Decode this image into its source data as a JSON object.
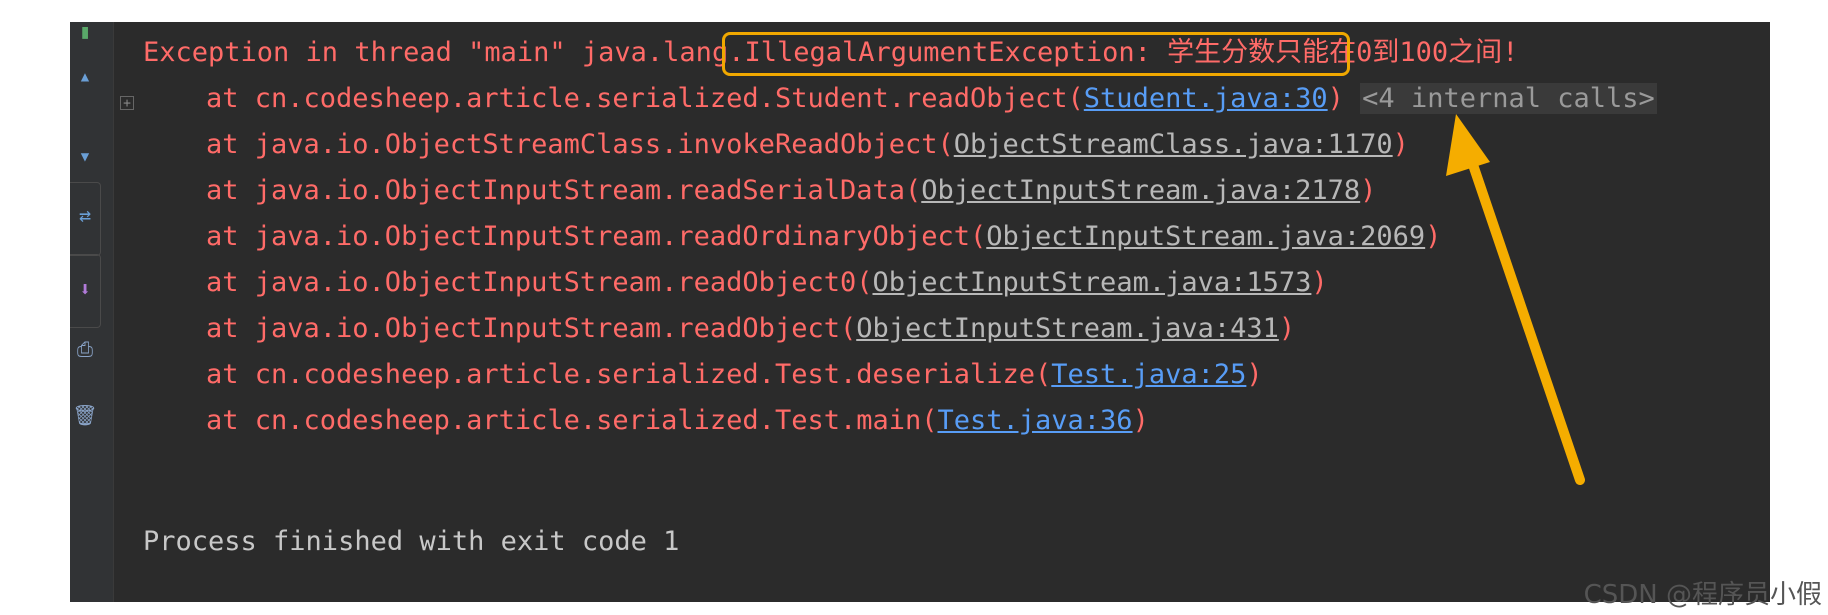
{
  "console": {
    "exception_prefix": "Exception in thread \"main\" java.lang",
    "exception_highlight": ".IllegalArgumentException: 学生分数只能在0到100之间!",
    "stack": [
      {
        "text": "at cn.codesheep.article.serialized.Student.readObject(",
        "link": "Student.java:30",
        "link_type": "user",
        "suffix": ")"
      },
      {
        "text": "at java.io.ObjectStreamClass.invokeReadObject(",
        "link": "ObjectStreamClass.java:1170",
        "link_type": "library",
        "suffix": ")"
      },
      {
        "text": "at java.io.ObjectInputStream.readSerialData(",
        "link": "ObjectInputStream.java:2178",
        "link_type": "library",
        "suffix": ")"
      },
      {
        "text": "at java.io.ObjectInputStream.readOrdinaryObject(",
        "link": "ObjectInputStream.java:2069",
        "link_type": "library",
        "suffix": ")"
      },
      {
        "text": "at java.io.ObjectInputStream.readObject0(",
        "link": "ObjectInputStream.java:1573",
        "link_type": "library",
        "suffix": ")"
      },
      {
        "text": "at java.io.ObjectInputStream.readObject(",
        "link": "ObjectInputStream.java:431",
        "link_type": "library",
        "suffix": ")"
      },
      {
        "text": "at cn.codesheep.article.serialized.Test.deserialize(",
        "link": "Test.java:25",
        "link_type": "user",
        "suffix": ")"
      },
      {
        "text": "at cn.codesheep.article.serialized.Test.main(",
        "link": "Test.java:36",
        "link_type": "user",
        "suffix": ")"
      }
    ],
    "internal_calls": "<4 internal calls>",
    "process_finished": "Process finished with exit code 1"
  },
  "colors": {
    "error_red": "#ff6b68",
    "link_blue": "#589df6",
    "highlight_orange": "#f0a800",
    "console_bg": "#2b2b2b"
  },
  "watermark": "CSDN @程序员小假",
  "icons": [
    "rerun-icon",
    "stop-icon",
    "print-icon",
    "trash-icon",
    "expand-plus-icon",
    "arrow-annotation-icon"
  ]
}
